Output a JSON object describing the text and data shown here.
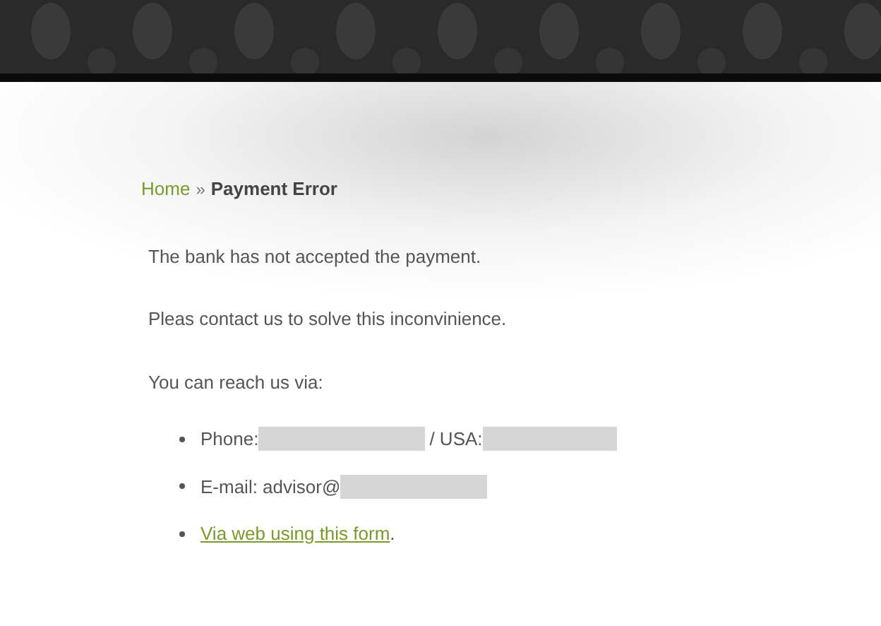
{
  "breadcrumb": {
    "home": "Home",
    "separator": "»",
    "current": "Payment Error"
  },
  "paragraphs": [
    "The bank has not accepted the payment.",
    "Pleas contact us to solve this inconvinience.",
    "You can reach us via:"
  ],
  "contacts": [
    {
      "parts": [
        {
          "kind": "text",
          "text": "Phone:"
        },
        {
          "kind": "redacted"
        },
        {
          "kind": "text",
          "text": "/ USA:"
        },
        {
          "kind": "redacted"
        }
      ]
    },
    {
      "parts": [
        {
          "kind": "text",
          "text": "E-mail: advisor@"
        },
        {
          "kind": "redacted"
        }
      ]
    },
    {
      "parts": [
        {
          "kind": "link",
          "text": "Via web using this form"
        },
        {
          "kind": "text",
          "text": "."
        }
      ]
    }
  ]
}
